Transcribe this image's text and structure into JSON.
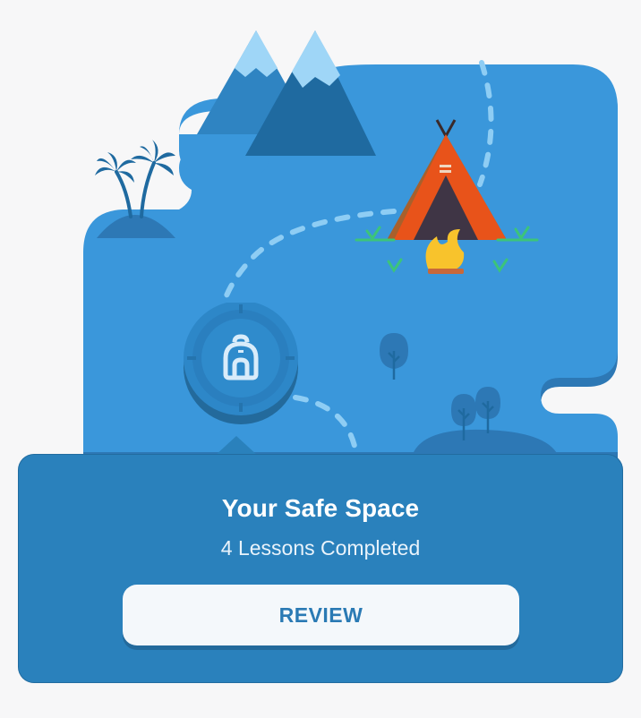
{
  "map": {
    "colors": {
      "background": "#f7f7f8",
      "land": "#3a97db",
      "land_shadow": "#2d78b5",
      "path_dashes": "#8ecdf4",
      "mountain_dark": "#1f6aa0",
      "mountain_light": "#2f84c2",
      "snow": "#9fd6f7",
      "tent_orange": "#e8531a",
      "tent_brown": "#a8602c",
      "campfire": "#f8c32c",
      "grass": "#3cc47a"
    },
    "decorations": [
      "mountains-illustration",
      "palm-trees-illustration",
      "tent-illustration",
      "campfire-illustration",
      "tree-illustration",
      "bushes-illustration"
    ]
  },
  "lesson_node": {
    "icon": "backpack-icon",
    "state": "completed"
  },
  "popup": {
    "title": "Your Safe Space",
    "subtitle": "4 Lessons Completed",
    "button_label": "REVIEW"
  }
}
